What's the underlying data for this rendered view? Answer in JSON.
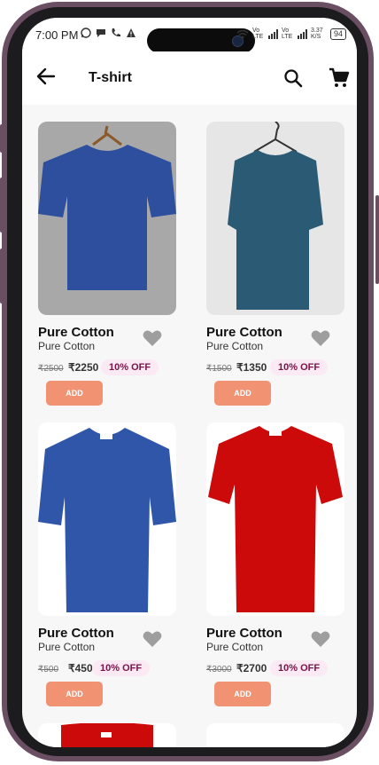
{
  "status_bar": {
    "time": "7:00 PM",
    "network_1": "Vo LTE",
    "network_2": "Vo LTE",
    "speed": "3.37 K/S",
    "battery": "94"
  },
  "app_bar": {
    "title": "T-shirt"
  },
  "products": [
    {
      "name": "Pure Cotton",
      "subtitle": "Pure Cotton",
      "old_price": "₹2500",
      "price": "₹2250",
      "discount": "10% OFF",
      "add_label": "ADD",
      "shirt_color": "#2e4f9e"
    },
    {
      "name": "Pure Cotton",
      "subtitle": "Pure Cotton",
      "old_price": "₹1500",
      "price": "₹1350",
      "discount": "10% OFF",
      "add_label": "ADD",
      "shirt_color": "#2a5a74"
    },
    {
      "name": "Pure Cotton",
      "subtitle": "Pure Cotton",
      "old_price": "₹500",
      "price": "₹450",
      "discount": "10% OFF",
      "add_label": "ADD",
      "shirt_color": "#2f56a8"
    },
    {
      "name": "Pure Cotton",
      "subtitle": "Pure Cotton",
      "old_price": "₹3000",
      "price": "₹2700",
      "discount": "10% OFF",
      "add_label": "ADD",
      "shirt_color": "#cc0a0a"
    }
  ],
  "colors": {
    "accent_button": "#f19272",
    "discount_text": "#7a1248",
    "discount_bg": "#fbe9f4",
    "frame": "#6a4e62"
  },
  "icons": {
    "back": "arrow-left-icon",
    "search": "search-icon",
    "cart": "cart-icon",
    "favorite": "heart-icon"
  }
}
